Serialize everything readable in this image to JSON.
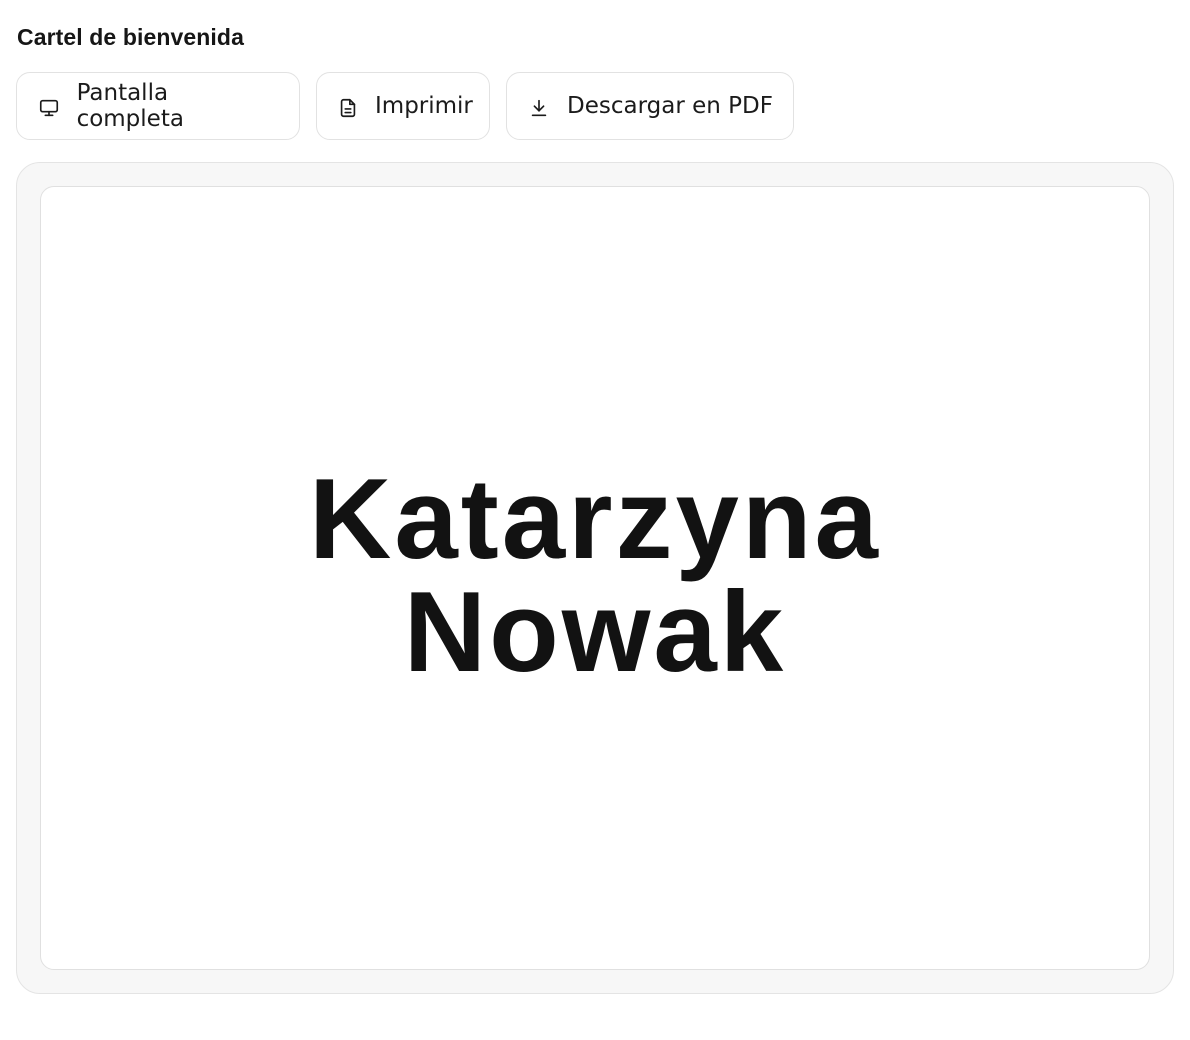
{
  "page": {
    "title": "Cartel de bienvenida"
  },
  "toolbar": {
    "fullscreen_label": "Pantalla completa",
    "fullscreen_icon": "monitor-icon",
    "print_label": "Imprimir",
    "print_icon": "document-icon",
    "download_label": "Descargar en PDF",
    "download_icon": "download-icon"
  },
  "sign": {
    "first_name": "Katarzyna",
    "last_name": "Nowak"
  },
  "colors": {
    "text": "#141414",
    "border": "#e2e2e2",
    "frame_background": "#f7f7f7",
    "sign_background": "#ffffff"
  }
}
